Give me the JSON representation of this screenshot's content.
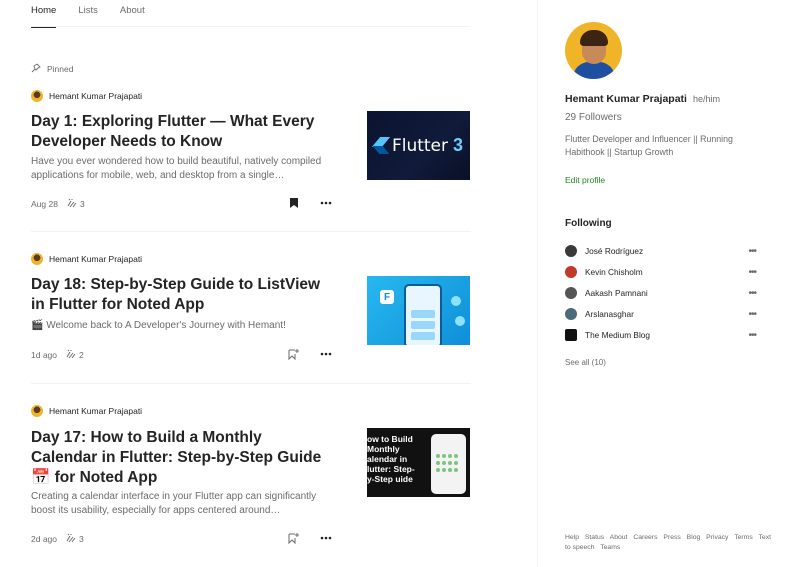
{
  "tabs": [
    {
      "label": "Home"
    },
    {
      "label": "Lists"
    },
    {
      "label": "About"
    }
  ],
  "pinned_label": "Pinned",
  "posts": [
    {
      "author": "Hemant Kumar Prajapati",
      "title": "Day 1: Exploring Flutter — What Every Developer Needs to Know",
      "subtitle": "Have you ever wondered how to build beautiful, natively compiled applications for mobile, web, and desktop from a single…",
      "date": "Aug 28",
      "claps": "3",
      "thumb_text": "Flutter",
      "thumb_badge": "3"
    },
    {
      "author": "Hemant Kumar Prajapati",
      "title": "Day 18: Step-by-Step Guide to ListView in Flutter for Noted App",
      "subtitle": "🎬 Welcome back to A Developer's Journey with Hemant!",
      "date": "1d ago",
      "claps": "2"
    },
    {
      "author": "Hemant Kumar Prajapati",
      "title": "Day 17: How to Build a Monthly Calendar in Flutter: Step-by-Step Guide 📅 for Noted App",
      "subtitle": "Creating a calendar interface in your Flutter app can significantly boost its usability, especially for apps centered around…",
      "date": "2d ago",
      "claps": "3",
      "thumb_text": "ow to Build Monthly alendar in lutter: Step- y-Step uide"
    }
  ],
  "profile": {
    "name": "Hemant Kumar Prajapati",
    "pronoun": "he/him",
    "followers": "29 Followers",
    "bio": "Flutter Developer and Influencer || Running Habithook || Startup Growth",
    "edit_label": "Edit profile"
  },
  "following": {
    "title": "Following",
    "items": [
      {
        "name": "José Rodríguez",
        "color": "#3a3a3a"
      },
      {
        "name": "Kevin Chisholm",
        "color": "#c0392b"
      },
      {
        "name": "Aakash Pamnani",
        "color": "#555555"
      },
      {
        "name": "Arslanasghar",
        "color": "#4a6b7a"
      },
      {
        "name": "The Medium Blog",
        "color": "#111111"
      }
    ],
    "see_all": "See all (10)"
  },
  "footer_links": [
    "Help",
    "Status",
    "About",
    "Careers",
    "Press",
    "Blog",
    "Privacy",
    "Terms",
    "Text to speech",
    "Teams"
  ]
}
